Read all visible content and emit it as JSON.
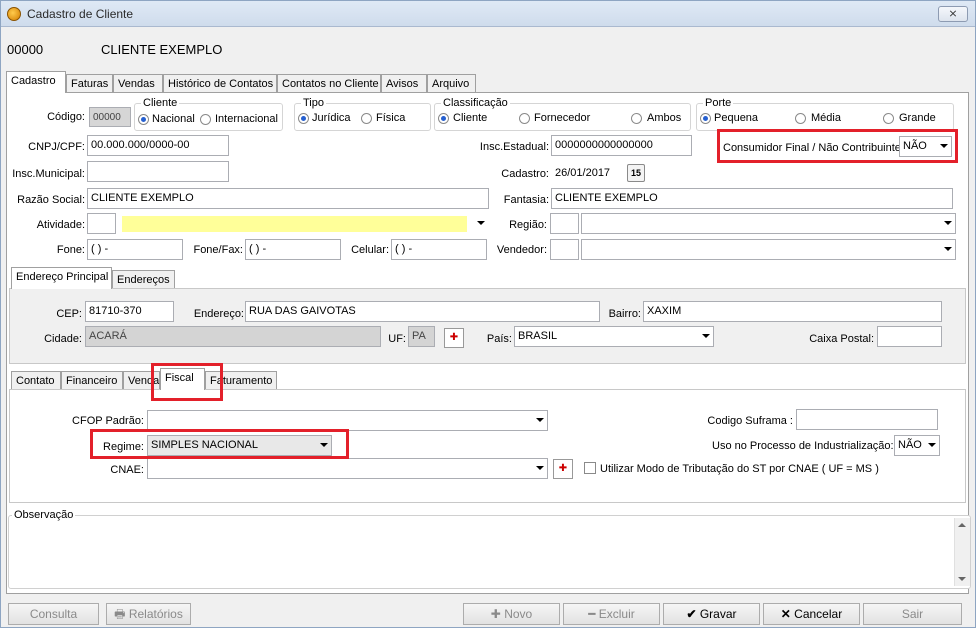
{
  "window": {
    "title": "Cadastro de Cliente",
    "close_label": "⨯"
  },
  "header": {
    "code": "00000",
    "name": "CLIENTE EXEMPLO"
  },
  "main_tabs": [
    "Cadastro",
    "Faturas",
    "Vendas",
    "Histórico de Contatos",
    "Contatos no Cliente",
    "Avisos",
    "Arquivo"
  ],
  "form": {
    "codigo_label": "Código:",
    "codigo_value": "00000",
    "cliente_group": "Cliente",
    "nacional": "Nacional",
    "internacional": "Internacional",
    "tipo_group": "Tipo",
    "juridica": "Jurídica",
    "fisica": "Física",
    "classificacao_group": "Classificação",
    "cliente": "Cliente",
    "fornecedor": "Fornecedor",
    "ambos": "Ambos",
    "porte_group": "Porte",
    "pequena": "Pequena",
    "media": "Média",
    "grande": "Grande",
    "cnpj_label": "CNPJ/CPF:",
    "cnpj_value": "00.000.000/0000-00",
    "insc_est_label": "Insc.Estadual:",
    "insc_est_value": "0000000000000000",
    "consumidor_label": "Consumidor Final / Não Contribuinte:",
    "consumidor_value": "NÃO",
    "insc_mun_label": "Insc.Municipal:",
    "cadastro_label": "Cadastro:",
    "cadastro_value": "26/01/2017",
    "cal_label": "15",
    "razao_label": "Razão Social:",
    "razao_value": "CLIENTE EXEMPLO",
    "fantasia_label": "Fantasia:",
    "fantasia_value": "CLIENTE EXEMPLO",
    "atividade_label": "Atividade:",
    "regiao_label": "Região:",
    "fone_label": "Fone:",
    "fone_value": "(  )   -",
    "fonefax_label": "Fone/Fax:",
    "fonefax_value": "(  )   -",
    "celular_label": "Celular:",
    "celular_value": "(  )   -",
    "vendedor_label": "Vendedor:"
  },
  "address_tabs": [
    "Endereço Principal",
    "Endereços"
  ],
  "address": {
    "cep_label": "CEP:",
    "cep_value": "81710-370",
    "endereco_label": "Endereço:",
    "endereco_value": "RUA DAS GAIVOTAS",
    "bairro_label": "Bairro:",
    "bairro_value": "XAXIM",
    "cidade_label": "Cidade:",
    "cidade_value": "ACARÁ",
    "uf_label": "UF:",
    "uf_value": "PA",
    "pais_label": "País:",
    "pais_value": "BRASIL",
    "caixa_label": "Caixa Postal:"
  },
  "sub_tabs": [
    "Contato",
    "Financeiro",
    "Venda",
    "Fiscal",
    "Faturamento"
  ],
  "fiscal": {
    "cfop_label": "CFOP Padrão:",
    "regime_label": "Regime:",
    "regime_value": "SIMPLES NACIONAL",
    "cnae_label": "CNAE:",
    "suframa_label": "Codigo Suframa :",
    "uso_label": "Uso no Processo de Industrialização:",
    "uso_value": "NÃO",
    "st_label": "Utilizar Modo de Tributação do ST por CNAE ( UF = MS )"
  },
  "obs": {
    "label": "Observação"
  },
  "buttons": {
    "consulta": "Consulta",
    "relatorios": "Relatórios",
    "novo": "Novo",
    "excluir": "Excluir",
    "gravar": "Gravar",
    "cancelar": "Cancelar",
    "sair": "Sair"
  },
  "colors": {
    "highlight": "#e3202a",
    "required_field": "#ffff99"
  }
}
